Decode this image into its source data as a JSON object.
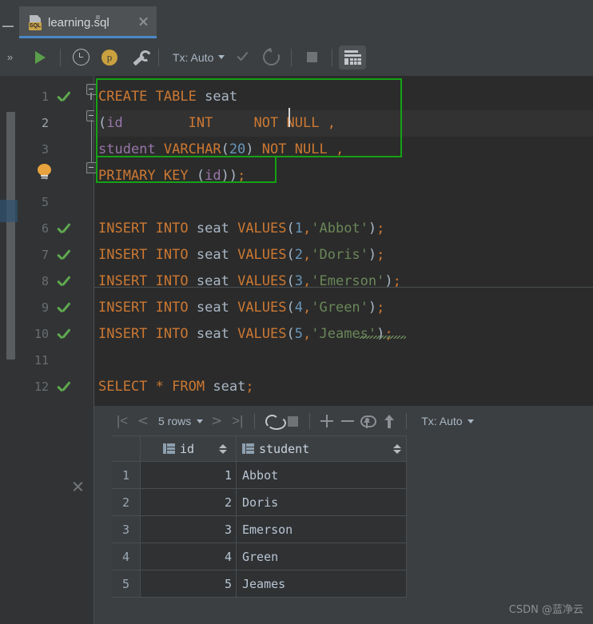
{
  "window": {
    "tab": {
      "name": "learning.sql",
      "icon": "sql-file-icon",
      "badge": "SQL",
      "close": "×"
    }
  },
  "leftbar": {
    "collapse_icon": "minus-icon",
    "expand_icon": "double-chevron-right-icon"
  },
  "toolbar": {
    "run_label": "run-icon",
    "history_label": "history-clock-icon",
    "profile_label": "p",
    "settings_label": "wrench-icon",
    "tx_label": "Tx: Auto",
    "commit_label": "commit-check-icon",
    "rollback_label": "rollback-icon",
    "stop_label": "stop-icon",
    "grid_label": "data-grid-icon"
  },
  "editor": {
    "lines": [
      {
        "n": "1",
        "check": true,
        "text": "CREATE TABLE seat"
      },
      {
        "n": "2",
        "check": false,
        "text": "(id        INT     NOT NULL ,"
      },
      {
        "n": "3",
        "check": false,
        "text": "student VARCHAR(20) NOT NULL ,"
      },
      {
        "n": "4",
        "check": false,
        "text": "PRIMARY KEY (id));"
      },
      {
        "n": "5",
        "check": false,
        "text": ""
      },
      {
        "n": "6",
        "check": true,
        "text": "INSERT INTO seat VALUES(1,'Abbot');"
      },
      {
        "n": "7",
        "check": true,
        "text": "INSERT INTO seat VALUES(2,'Doris');"
      },
      {
        "n": "8",
        "check": true,
        "text": "INSERT INTO seat VALUES(3,'Emerson');"
      },
      {
        "n": "9",
        "check": true,
        "text": "INSERT INTO seat VALUES(4,'Green');"
      },
      {
        "n": "10",
        "check": true,
        "text": "INSERT INTO seat VALUES(5,'Jeames');"
      },
      {
        "n": "11",
        "check": false,
        "text": ""
      },
      {
        "n": "12",
        "check": true,
        "text": "SELECT * FROM seat;"
      }
    ],
    "close_result_icon": "close-icon",
    "intention_icon": "lightbulb-icon",
    "selection_color": "#15a215"
  },
  "results": {
    "first_label": "|<",
    "prev_label": "<",
    "rows_label": "5 rows",
    "next_label": ">",
    "last_label": ">|",
    "refresh_label": "refresh-icon",
    "stop_label": "stop-icon",
    "add_label": "add-row-icon",
    "remove_label": "remove-row-icon",
    "revert_label": "revert-icon",
    "submit_label": "submit-icon",
    "tx_label": "Tx: Auto"
  },
  "table": {
    "columns": [
      "id",
      "student"
    ],
    "rows": [
      {
        "idx": "1",
        "id": "1",
        "student": "Abbot"
      },
      {
        "idx": "2",
        "id": "2",
        "student": "Doris"
      },
      {
        "idx": "3",
        "id": "3",
        "student": "Emerson"
      },
      {
        "idx": "4",
        "id": "4",
        "student": "Green"
      },
      {
        "idx": "5",
        "id": "5",
        "student": "Jeames"
      }
    ]
  },
  "watermark": "CSDN @蓝净云"
}
